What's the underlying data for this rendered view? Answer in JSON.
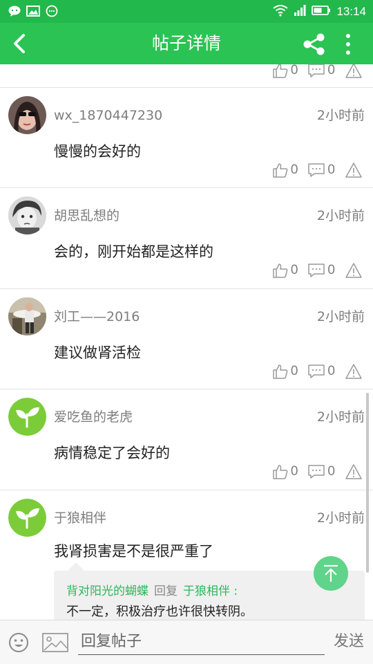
{
  "status_bar": {
    "time": "13:14"
  },
  "app_bar": {
    "title": "帖子详情"
  },
  "top_stub": {
    "likes": "0",
    "comments": "0"
  },
  "posts": [
    {
      "username": "wx_1870447230",
      "time": "2小时前",
      "content": "慢慢的会好的",
      "likes": "0",
      "comments": "0"
    },
    {
      "username": "胡思乱想的",
      "time": "2小时前",
      "content": "会的，刚开始都是这样的",
      "likes": "0",
      "comments": "0"
    },
    {
      "username": "刘工——2016",
      "time": "2小时前",
      "content": "建议做肾活检",
      "likes": "0",
      "comments": "0"
    },
    {
      "username": "爱吃鱼的老虎",
      "time": "2小时前",
      "content": "病情稳定了会好的",
      "likes": "0",
      "comments": "0"
    },
    {
      "username": "于狼相伴",
      "time": "2小时前",
      "content": "我肾损害是不是很严重了",
      "reply": {
        "from": "背对阳光的蝴蝶",
        "verb": "回复",
        "to": "于狼相伴 :",
        "text": "不一定，积极治疗也许很快转阴。"
      }
    }
  ],
  "reply_bar": {
    "placeholder": "回复帖子",
    "send": "发送"
  },
  "colors": {
    "brand_green": "#2bc354",
    "status_green": "#22b84c",
    "reply_name_green": "#2bb75a",
    "fab_green": "#5fd48a"
  }
}
